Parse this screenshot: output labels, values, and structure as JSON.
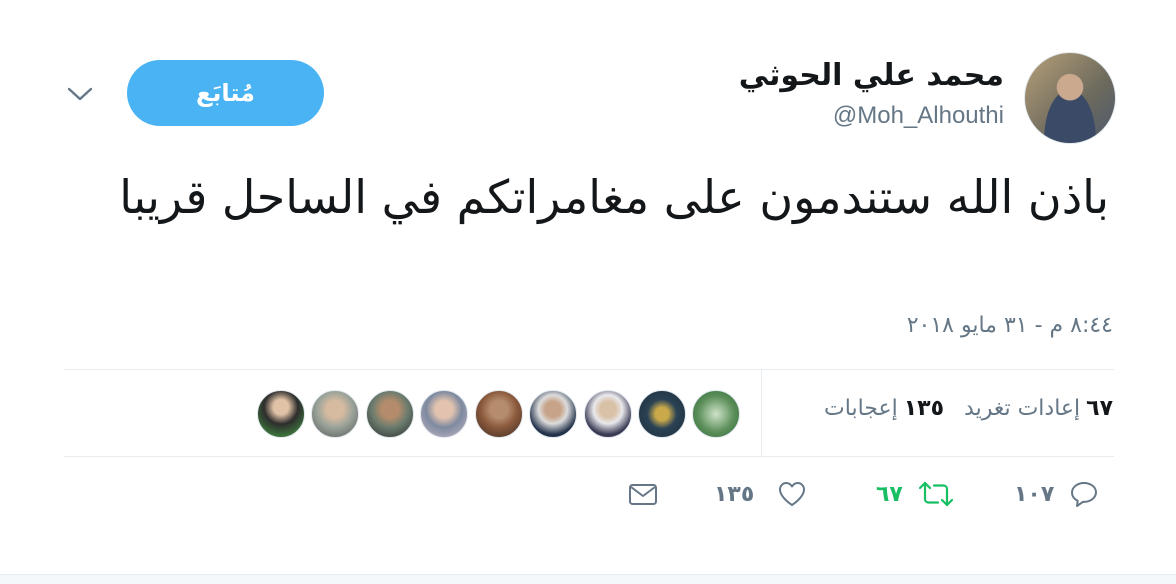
{
  "author": {
    "name": "محمد علي الحوثي",
    "handle": "@Moh_Alhouthi"
  },
  "follow_button": {
    "label": "مُتابَع"
  },
  "tweet": {
    "text": "باذن الله ستندمون على مغامراتكم في الساحل قريبا",
    "timestamp": "٨:٤٤ م - ٣١ مايو ٢٠١٨"
  },
  "stats": {
    "retweets_count": "٦٧",
    "retweets_label": "إعادات تغريد",
    "likes_count": "١٣٥",
    "likes_label": "إعجابات"
  },
  "actions": {
    "reply_count": "١٠٧",
    "retweet_count": "٦٧",
    "like_count": "١٣٥"
  },
  "colors": {
    "accent": "#4ab3f4",
    "retweet_green": "#17bf63",
    "muted": "#657786"
  }
}
